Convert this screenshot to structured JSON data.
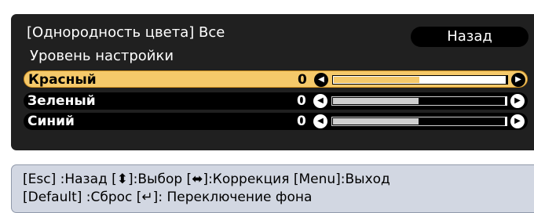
{
  "menu": {
    "title": "[Однородность цвета]  Все",
    "subtitle": "Уровень настройки",
    "back_label": "Назад",
    "rows": [
      {
        "label": "Красный",
        "value": "0",
        "level": 0.5,
        "selected": true
      },
      {
        "label": "Зеленый",
        "value": "0",
        "level": 0.5,
        "selected": false
      },
      {
        "label": "Синий",
        "value": "0",
        "level": 0.5,
        "selected": false
      }
    ],
    "left_arrow_icon": "◀",
    "right_arrow_icon": "▶"
  },
  "help": {
    "line1": "[Esc] :Назад  [⬍]:Выбор  [⬌]:Коррекция [Menu]:Выход",
    "line2": "[Default] :Сброс   [↵]: Переключение фона"
  },
  "colors": {
    "panel_bg": "#202020",
    "highlight": "#f5c96a",
    "help_bg": "#d2d7e2"
  }
}
